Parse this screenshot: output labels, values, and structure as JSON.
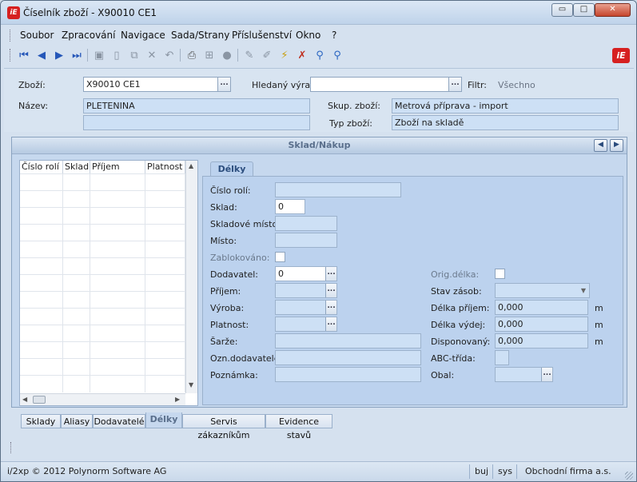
{
  "window": {
    "title": "Číselník zboží - X90010 CE1",
    "logo_text": "iE",
    "minimize_glyph": "▭",
    "maximize_glyph": "□",
    "close_glyph": "✕"
  },
  "menu": [
    "Soubor",
    "Zpracování",
    "Navigace",
    "Sada/Strany",
    "Příslušenství",
    "Okno",
    "?"
  ],
  "toolbar": {
    "icons": [
      "first-record-icon",
      "previous-record-icon",
      "next-record-icon",
      "last-record-icon",
      "save-icon",
      "new-icon",
      "copy-icon",
      "delete-icon",
      "undo-icon",
      "print-icon",
      "structure-icon",
      "stop-icon",
      "edit-icon",
      "edit-alt-icon",
      "filter-icon",
      "filter-clear-icon",
      "search-icon",
      "search-advanced-icon"
    ],
    "brand": "iE"
  },
  "header": {
    "zbozi_label": "Zboží:",
    "zbozi_value": "X90010 CE1",
    "hledany_label": "Hledaný výraz:",
    "hledany_value": "",
    "filtr_label": "Filtr:",
    "filtr_value": "Všechno",
    "nazev_label": "Název:",
    "nazev_value": "PLETENINA",
    "nazev2_value": "",
    "skup_label": "Skup. zboží:",
    "skup_value": "Metrová příprava - import",
    "typ_label": "Typ zboží:",
    "typ_value": "Zboží na skladě",
    "ellipsis": "..."
  },
  "panel": {
    "title": "Sklad/Nákup",
    "prev_glyph": "◀",
    "next_glyph": "▶"
  },
  "grid": {
    "columns": [
      "Číslo rolí",
      "Sklad",
      "Příjem",
      "Platnost"
    ],
    "rows": 13
  },
  "tab": {
    "active": "Délky"
  },
  "form": {
    "cislo_roli": {
      "label": "Číslo rolí:",
      "value": ""
    },
    "sklad": {
      "label": "Sklad:",
      "value": "0"
    },
    "skladove_misto": {
      "label": "Skladové místo:",
      "value": ""
    },
    "misto": {
      "label": "Místo:",
      "value": ""
    },
    "zablokovano": {
      "label": "Zablokováno:"
    },
    "dodavatel": {
      "label": "Dodavatel:",
      "value": "0"
    },
    "prijem": {
      "label": "Příjem:",
      "value": ""
    },
    "vyroba": {
      "label": "Výroba:",
      "value": ""
    },
    "platnost": {
      "label": "Platnost:",
      "value": ""
    },
    "sarze": {
      "label": "Šarže:",
      "value": ""
    },
    "ozn_dodavatele": {
      "label": "Ozn.dodavatele:",
      "value": ""
    },
    "poznamka": {
      "label": "Poznámka:",
      "value": ""
    },
    "orig_delka": {
      "label": "Orig.délka:"
    },
    "stav_zasob": {
      "label": "Stav zásob:",
      "value": ""
    },
    "delka_prijem": {
      "label": "Délka příjem:",
      "value": "0,000",
      "unit": "m"
    },
    "delka_vydej": {
      "label": "Délka výdej:",
      "value": "0,000",
      "unit": "m"
    },
    "disponovany": {
      "label": "Disponovaný:",
      "value": "0,000",
      "unit": "m"
    },
    "abc_trida": {
      "label": "ABC-třída:",
      "value": ""
    },
    "obal": {
      "label": "Obal:",
      "value": ""
    }
  },
  "bottom_tabs": [
    "Sklady",
    "Aliasy",
    "Dodavatelé",
    "Délky",
    "Servis zákazníkům",
    "Evidence stavů"
  ],
  "status": {
    "copyright": "i/2xp © 2012 Polynorm Software AG",
    "user": "buj",
    "system": "sys",
    "company": "Obchodní firma a.s."
  },
  "colors": {
    "accent": "#d62020",
    "panel": "#c6d8ee",
    "readonly": "#cde0f5"
  }
}
